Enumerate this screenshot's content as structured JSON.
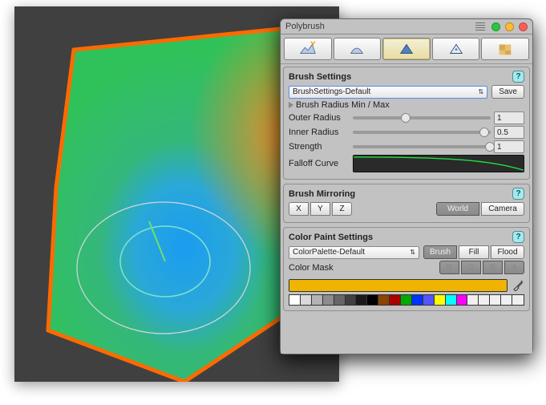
{
  "panel_title": "Polybrush",
  "tabs": [
    "raise-lower",
    "smooth",
    "paint",
    "prefab",
    "texture"
  ],
  "active_tab": 2,
  "brush_settings": {
    "heading": "Brush Settings",
    "preset_popup": "BrushSettings-Default",
    "save_label": "Save",
    "radius_minmax_label": "Brush Radius Min / Max",
    "outer_radius_label": "Outer Radius",
    "outer_radius_value": "1",
    "outer_slider_pos": 0.35,
    "inner_radius_label": "Inner Radius",
    "inner_radius_value": "0.5",
    "inner_slider_pos": 0.95,
    "strength_label": "Strength",
    "strength_value": "1",
    "strength_slider_pos": 1.0,
    "falloff_label": "Falloff Curve"
  },
  "mirroring": {
    "heading": "Brush Mirroring",
    "axes": [
      "X",
      "Y",
      "Z"
    ],
    "space_options": [
      "World",
      "Camera"
    ],
    "space_active": 0
  },
  "color_paint": {
    "heading": "Color Paint Settings",
    "palette_popup": "ColorPalette-Default",
    "modes": [
      "Brush",
      "Fill",
      "Flood"
    ],
    "mode_active": 0,
    "mask_label": "Color Mask",
    "mask_channels": [
      "R",
      "G",
      "B",
      "A"
    ],
    "current_color": "#f0b400",
    "swatches": [
      "#ffffff",
      "#d9d9d9",
      "#b3b3b3",
      "#8c8c8c",
      "#666666",
      "#404040",
      "#1a1a1a",
      "#000000",
      "#884400",
      "#aa0000",
      "#00aa00",
      "#0033ff",
      "#5555ff",
      "#ffff00",
      "#00ffff",
      "#ff00ff",
      "#f0f0f0",
      "#f0f0f0",
      "#f0f0f0",
      "#f0f0f0",
      "#f0f0f0"
    ]
  },
  "chart_data": {
    "type": "line",
    "title": "Falloff Curve",
    "x": [
      0,
      0.33,
      0.66,
      1
    ],
    "values": [
      1.0,
      0.95,
      0.75,
      0.25
    ],
    "xlabel": "",
    "ylabel": "",
    "ylim": [
      0,
      1
    ]
  }
}
